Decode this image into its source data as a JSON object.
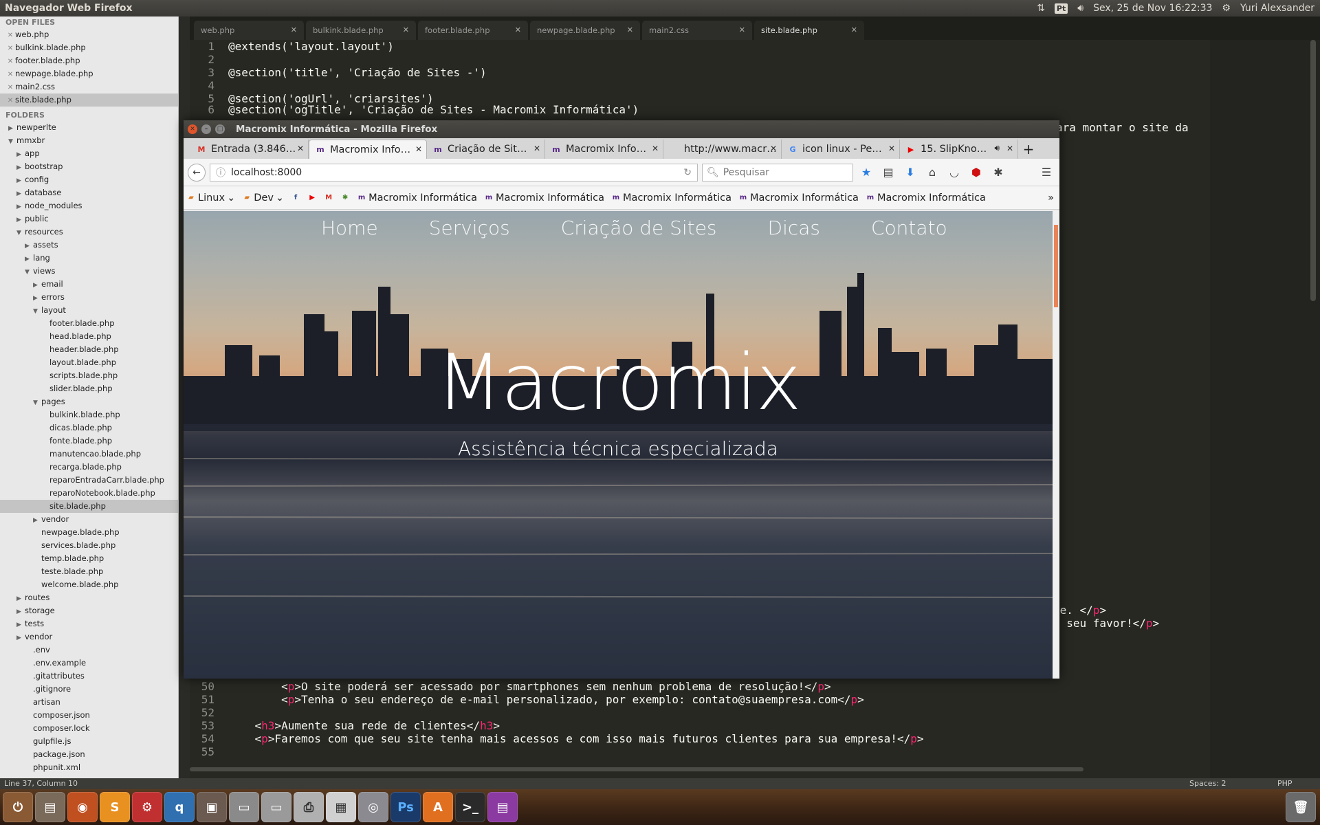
{
  "topbar": {
    "title": "Navegador Web Firefox",
    "keyboard": "Pt",
    "datetime": "Sex, 25 de Nov 16:22:33",
    "user": "Yuri Alexsander"
  },
  "sidebar": {
    "open_files_header": "OPEN FILES",
    "open_files": [
      "web.php",
      "bulkink.blade.php",
      "footer.blade.php",
      "newpage.blade.php",
      "main2.css",
      "site.blade.php"
    ],
    "folders_header": "FOLDERS",
    "tree": [
      {
        "label": "newperlte",
        "depth": 0,
        "type": "closed"
      },
      {
        "label": "mmxbr",
        "depth": 0,
        "type": "open"
      },
      {
        "label": "app",
        "depth": 1,
        "type": "closed"
      },
      {
        "label": "bootstrap",
        "depth": 1,
        "type": "closed"
      },
      {
        "label": "config",
        "depth": 1,
        "type": "closed"
      },
      {
        "label": "database",
        "depth": 1,
        "type": "closed"
      },
      {
        "label": "node_modules",
        "depth": 1,
        "type": "closed"
      },
      {
        "label": "public",
        "depth": 1,
        "type": "closed"
      },
      {
        "label": "resources",
        "depth": 1,
        "type": "open"
      },
      {
        "label": "assets",
        "depth": 2,
        "type": "closed"
      },
      {
        "label": "lang",
        "depth": 2,
        "type": "closed"
      },
      {
        "label": "views",
        "depth": 2,
        "type": "open"
      },
      {
        "label": "email",
        "depth": 3,
        "type": "closed"
      },
      {
        "label": "errors",
        "depth": 3,
        "type": "closed"
      },
      {
        "label": "layout",
        "depth": 3,
        "type": "open"
      },
      {
        "label": "footer.blade.php",
        "depth": 4,
        "type": "file"
      },
      {
        "label": "head.blade.php",
        "depth": 4,
        "type": "file"
      },
      {
        "label": "header.blade.php",
        "depth": 4,
        "type": "file"
      },
      {
        "label": "layout.blade.php",
        "depth": 4,
        "type": "file"
      },
      {
        "label": "scripts.blade.php",
        "depth": 4,
        "type": "file"
      },
      {
        "label": "slider.blade.php",
        "depth": 4,
        "type": "file"
      },
      {
        "label": "pages",
        "depth": 3,
        "type": "open"
      },
      {
        "label": "bulkink.blade.php",
        "depth": 4,
        "type": "file"
      },
      {
        "label": "dicas.blade.php",
        "depth": 4,
        "type": "file"
      },
      {
        "label": "fonte.blade.php",
        "depth": 4,
        "type": "file"
      },
      {
        "label": "manutencao.blade.php",
        "depth": 4,
        "type": "file"
      },
      {
        "label": "recarga.blade.php",
        "depth": 4,
        "type": "file"
      },
      {
        "label": "reparoEntradaCarr.blade.php",
        "depth": 4,
        "type": "file"
      },
      {
        "label": "reparoNotebook.blade.php",
        "depth": 4,
        "type": "file"
      },
      {
        "label": "site.blade.php",
        "depth": 4,
        "type": "file",
        "selected": true
      },
      {
        "label": "vendor",
        "depth": 3,
        "type": "closed"
      },
      {
        "label": "newpage.blade.php",
        "depth": 3,
        "type": "file"
      },
      {
        "label": "services.blade.php",
        "depth": 3,
        "type": "file"
      },
      {
        "label": "temp.blade.php",
        "depth": 3,
        "type": "file"
      },
      {
        "label": "teste.blade.php",
        "depth": 3,
        "type": "file"
      },
      {
        "label": "welcome.blade.php",
        "depth": 3,
        "type": "file"
      },
      {
        "label": "routes",
        "depth": 1,
        "type": "closed"
      },
      {
        "label": "storage",
        "depth": 1,
        "type": "closed"
      },
      {
        "label": "tests",
        "depth": 1,
        "type": "closed"
      },
      {
        "label": "vendor",
        "depth": 1,
        "type": "closed"
      },
      {
        "label": ".env",
        "depth": 2,
        "type": "file"
      },
      {
        "label": ".env.example",
        "depth": 2,
        "type": "file"
      },
      {
        "label": ".gitattributes",
        "depth": 2,
        "type": "file"
      },
      {
        "label": ".gitignore",
        "depth": 2,
        "type": "file"
      },
      {
        "label": "artisan",
        "depth": 2,
        "type": "file"
      },
      {
        "label": "composer.json",
        "depth": 2,
        "type": "file"
      },
      {
        "label": "composer.lock",
        "depth": 2,
        "type": "file"
      },
      {
        "label": "gulpfile.js",
        "depth": 2,
        "type": "file"
      },
      {
        "label": "package.json",
        "depth": 2,
        "type": "file"
      },
      {
        "label": "phpunit.xml",
        "depth": 2,
        "type": "file"
      }
    ]
  },
  "editor": {
    "tabs": [
      {
        "label": "web.php",
        "active": false
      },
      {
        "label": "bulkink.blade.php",
        "active": false
      },
      {
        "label": "footer.blade.php",
        "active": false
      },
      {
        "label": "newpage.blade.php",
        "active": false
      },
      {
        "label": "main2.css",
        "active": false
      },
      {
        "label": "site.blade.php",
        "active": true
      }
    ],
    "top_lines": [
      {
        "n": "1",
        "code": "@extends('layout.layout')"
      },
      {
        "n": "2",
        "code": ""
      },
      {
        "n": "3",
        "code": "@section('title', 'Criação de Sites -')"
      },
      {
        "n": "4",
        "code": ""
      },
      {
        "n": "5",
        "code": "@section('ogUrl', 'criarsites')"
      },
      {
        "n": "6",
        "code": "@section('ogTitle', 'Criação de Sites - Macromix Informática')"
      }
    ],
    "line7_tail": "ara montar o site da",
    "right_frag1_a": "de. </",
    "right_frag1_tag": "p",
    "right_frag1_b": ">",
    "right_frag2_a": "o seu favor!</",
    "right_frag2_tag": "p",
    "right_frag2_b": ">",
    "bottom_lines": [
      {
        "n": "50",
        "indent": "        ",
        "open": "p",
        "text": "O site poderá ser acessado por smartphones sem nenhum problema de resolução!",
        "close": "p"
      },
      {
        "n": "51",
        "indent": "        ",
        "open": "p",
        "text": "Tenha o seu endereço de e-mail personalizado, por exemplo: contato@suaempresa.com",
        "close": "p"
      },
      {
        "n": "52",
        "indent": "",
        "open": "",
        "text": "",
        "close": ""
      },
      {
        "n": "53",
        "indent": "    ",
        "open": "h3",
        "text": "Aumente sua rede de clientes",
        "close": "h3"
      },
      {
        "n": "54",
        "indent": "    ",
        "open": "p",
        "text": "Faremos com que seu site tenha mais acessos e com isso mais futuros clientes para sua empresa!",
        "close": "p"
      },
      {
        "n": "55",
        "indent": "",
        "open": "",
        "text": "",
        "close": ""
      }
    ]
  },
  "status": {
    "position": "Line 37, Column 10",
    "spaces": "Spaces: 2",
    "syntax": "PHP"
  },
  "firefox": {
    "window_title": "Macromix Informática - Mozilla Firefox",
    "tabs": [
      {
        "label": "Entrada (3.846…",
        "icon": "gmail-icon",
        "active": false
      },
      {
        "label": "Macromix Info…",
        "icon": "macromix-icon",
        "active": true
      },
      {
        "label": "Criação de Sit…",
        "icon": "macromix-icon",
        "active": false
      },
      {
        "label": "Macromix Info…",
        "icon": "macromix-icon",
        "active": false
      },
      {
        "label": "http://www.macr…",
        "icon": "",
        "active": false
      },
      {
        "label": "icon linux - Pe…",
        "icon": "google-icon",
        "active": false
      },
      {
        "label": "15. SlipKno…",
        "icon": "youtube-icon",
        "active": false
      }
    ],
    "url": "localhost:8000",
    "search_placeholder": "Pesquisar",
    "bookmarks": [
      {
        "label": "Linux",
        "type": "folder"
      },
      {
        "label": "Dev",
        "type": "folder"
      },
      {
        "label": "Macromix Informática",
        "type": "link"
      },
      {
        "label": "Macromix Informática",
        "type": "link"
      },
      {
        "label": "Macromix Informática",
        "type": "link"
      },
      {
        "label": "Macromix Informática",
        "type": "link"
      },
      {
        "label": "Macromix Informática",
        "type": "link"
      }
    ],
    "page": {
      "nav": [
        "Home",
        "Serviços",
        "Criação de Sites",
        "Dicas",
        "Contato"
      ],
      "heading": "Macromix",
      "subheading": "Assistência técnica especializada"
    }
  },
  "colors": {
    "editor_bg": "#272822",
    "tag": "#f92672",
    "accent_scroll": "#e8845a"
  }
}
